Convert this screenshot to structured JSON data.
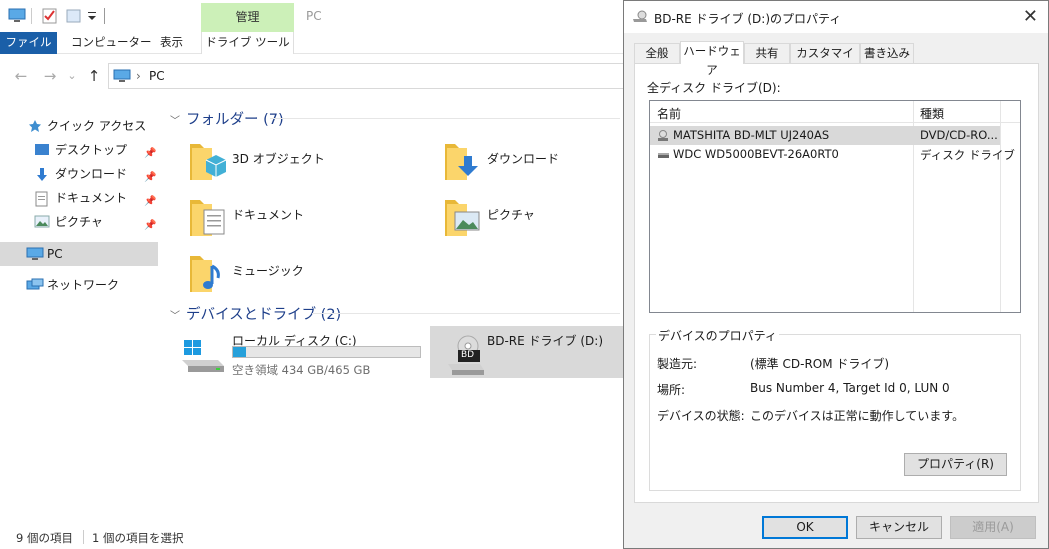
{
  "explorer": {
    "ribbon": {
      "manage_tab": "管理",
      "window_title": "PC",
      "tabs": {
        "file": "ファイル",
        "computer": "コンピューター",
        "view": "表示",
        "drive_tools": "ドライブ ツール"
      }
    },
    "address": {
      "crumb": "PC",
      "separator": "›"
    },
    "sidebar": {
      "quick_access": "クイック アクセス",
      "desktop": "デスクトップ",
      "downloads": "ダウンロード",
      "documents": "ドキュメント",
      "pictures": "ピクチャ",
      "pc": "PC",
      "network": "ネットワーク"
    },
    "folders_group": "フォルダー (7)",
    "folders": [
      "3D オブジェクト",
      "ダウンロード",
      "ドキュメント",
      "ピクチャ",
      "ミュージック"
    ],
    "devices_group": "デバイスとドライブ (2)",
    "drive_c": {
      "name": "ローカル ディスク (C:)",
      "space": "空き領域 434 GB/465 GB",
      "used_fraction": 0.067
    },
    "drive_d": {
      "name": "BD-RE ドライブ (D:)",
      "badge": "BD"
    },
    "status": {
      "items": "9 個の項目",
      "selected": "1 個の項目を選択"
    }
  },
  "dialog": {
    "title": "BD-RE ドライブ (D:)のプロパティ",
    "tabs": [
      "全般",
      "ハードウェア",
      "共有",
      "カスタマイズ",
      "書き込み"
    ],
    "all_drives_label": "全ディスク ドライブ(D):",
    "columns": {
      "name": "名前",
      "type": "種類"
    },
    "drives": [
      {
        "name": "MATSHITA BD-MLT UJ240AS",
        "type": "DVD/CD-RO..."
      },
      {
        "name": "WDC WD5000BEVT-26A0RT0",
        "type": "ディスク ドライブ"
      }
    ],
    "device_props": {
      "legend": "デバイスのプロパティ",
      "manufacturer_label": "製造元:",
      "manufacturer": "(標準 CD-ROM ドライブ)",
      "location_label": "場所:",
      "location": "Bus Number 4, Target Id 0, LUN 0",
      "status_label": "デバイスの状態:",
      "status": "このデバイスは正常に動作しています。"
    },
    "buttons": {
      "properties": "プロパティ(R)",
      "ok": "OK",
      "cancel": "キャンセル",
      "apply": "適用(A)"
    }
  },
  "colors": {
    "accent": "#0078d7",
    "file_tab": "#1a5fa8",
    "manage_tab": "#ccf0b8",
    "progress": "#26a0da"
  }
}
